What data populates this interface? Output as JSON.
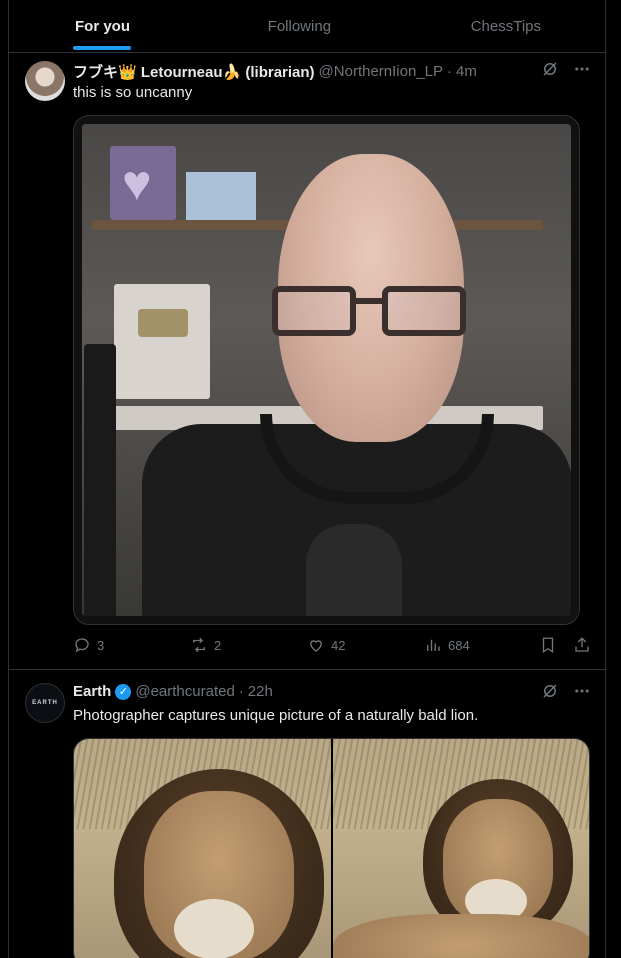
{
  "tabs": [
    {
      "label": "For you",
      "active": true
    },
    {
      "label": "Following",
      "active": false
    },
    {
      "label": "ChessTips",
      "active": false
    }
  ],
  "posts": [
    {
      "author": "フブキ👑 Letourneau🍌 (librarian)",
      "handle": "@NorthernIion_LP",
      "time": "4m",
      "text": "this is so uncanny",
      "media": "video-still-bald-man-with-glasses-and-headphones",
      "stats": {
        "replies": "3",
        "reposts": "2",
        "likes": "42",
        "views": "684"
      }
    },
    {
      "author": "Earth",
      "verified": true,
      "handle": "@earthcurated",
      "time": "22h",
      "text": "Photographer captures unique picture of a naturally bald lion.",
      "avatar_text": "EARTH",
      "media": "two-photos-of-lion"
    }
  ],
  "colors": {
    "background": "#000000",
    "accent": "#1d9bf0",
    "text": "#e7e9ea",
    "muted": "#71767b",
    "border": "#2f3336"
  },
  "icons": [
    "grok-icon",
    "more-icon",
    "reply-icon",
    "repost-icon",
    "like-icon",
    "views-icon",
    "bookmark-icon",
    "share-icon",
    "verified-badge-icon"
  ]
}
